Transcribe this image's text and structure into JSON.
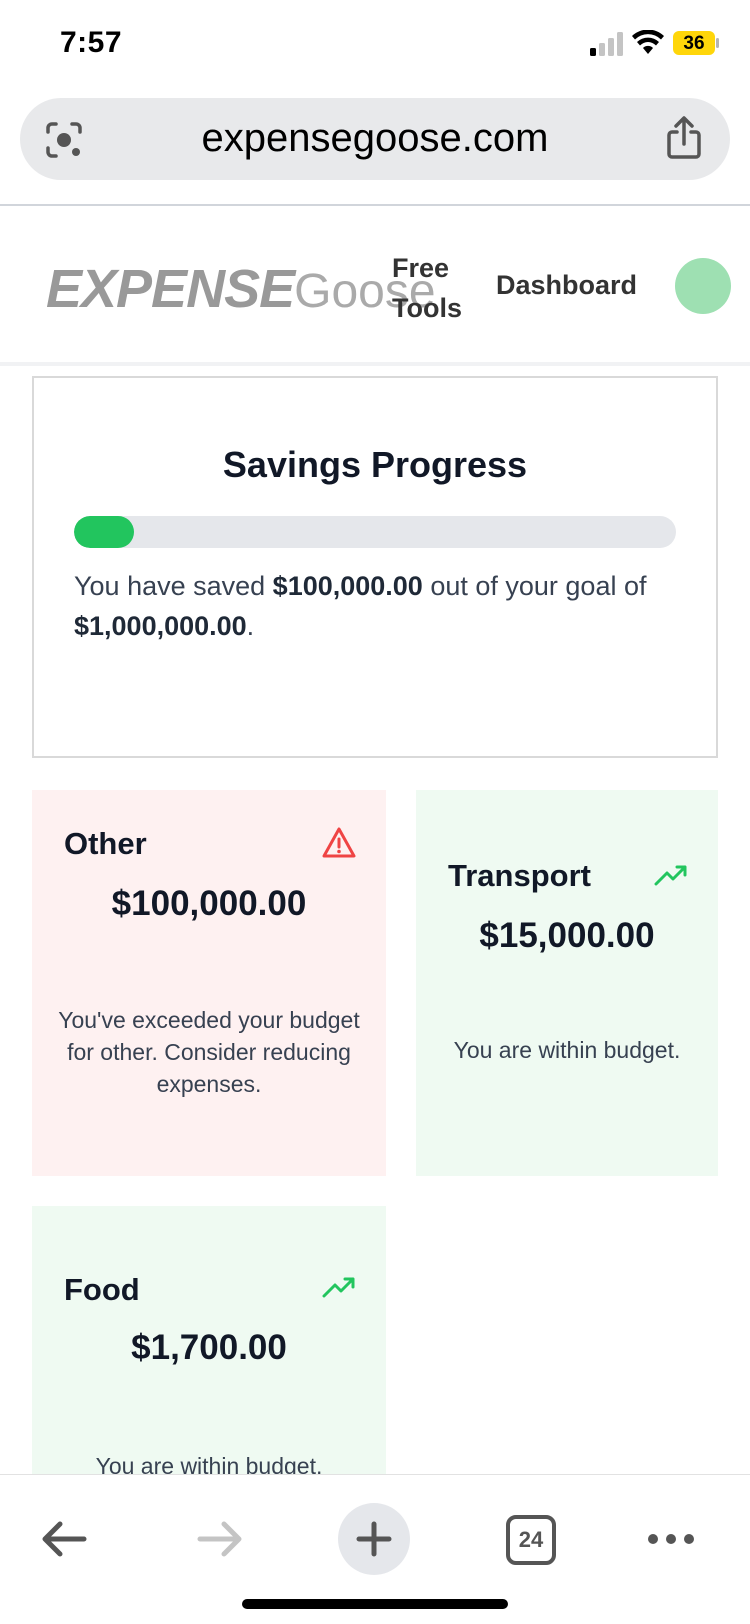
{
  "status_bar": {
    "time": "7:57",
    "battery": "36"
  },
  "browser": {
    "url": "expensegoose.com",
    "tab_count": "24"
  },
  "header": {
    "logo_bold": "EXPENSE",
    "logo_light": "Goose",
    "nav": {
      "free_tools": "Free Tools",
      "dashboard": "Dashboard"
    }
  },
  "savings": {
    "title": "Savings Progress",
    "progress_fraction": 0.1,
    "text_prefix": "You have saved ",
    "saved": "$100,000.00",
    "text_middle": " out of your goal of ",
    "goal": "$1,000,000.00",
    "text_suffix": "."
  },
  "categories": [
    {
      "name": "Other",
      "amount": "$100,000.00",
      "message": "You've exceeded your budget for other. Consider reducing expenses.",
      "status": "over",
      "icon": "warning-icon"
    },
    {
      "name": "Transport",
      "amount": "$15,000.00",
      "message": "You are within budget.",
      "status": "ok",
      "icon": "trending-up-icon"
    },
    {
      "name": "Food",
      "amount": "$1,700.00",
      "message": "You are within budget.",
      "status": "ok",
      "icon": "trending-up-icon"
    }
  ],
  "colors": {
    "accent_green": "#22c55e",
    "warning_red": "#ef4444",
    "over_bg": "#fef1f1",
    "ok_bg": "#effaf2"
  }
}
